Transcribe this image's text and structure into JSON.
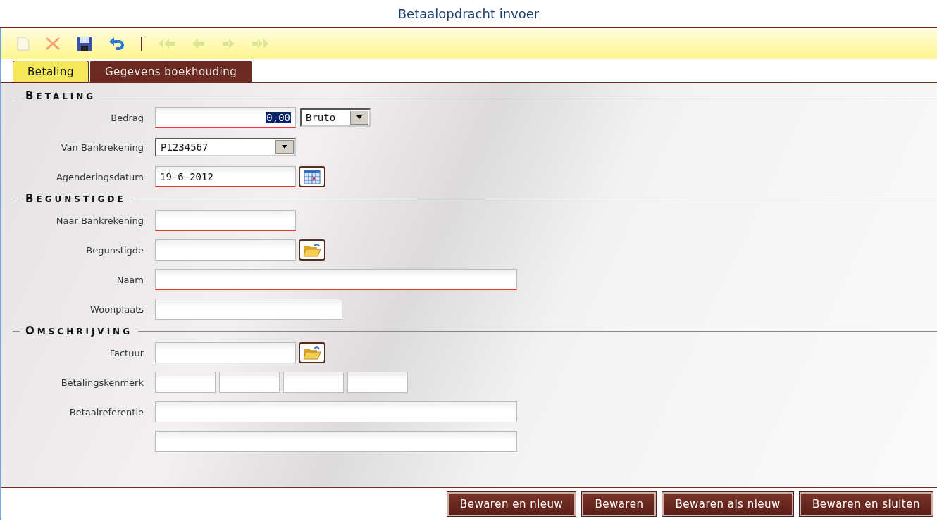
{
  "window": {
    "title": "Betaalopdracht invoer"
  },
  "toolbar": [
    {
      "kind": "new",
      "disabled": false
    },
    {
      "kind": "delete",
      "disabled": false
    },
    {
      "kind": "save",
      "disabled": false
    },
    {
      "kind": "undo",
      "disabled": false
    },
    {
      "kind": "separator"
    },
    {
      "kind": "first",
      "disabled": true
    },
    {
      "kind": "previous",
      "disabled": true
    },
    {
      "kind": "next",
      "disabled": true
    },
    {
      "kind": "last",
      "disabled": true
    }
  ],
  "tabs": [
    {
      "label": "Betaling",
      "selected": true
    },
    {
      "label": "Gegevens boekhouding",
      "selected": false
    }
  ],
  "sections": [
    {
      "title": "BETALING",
      "fields": [
        {
          "label": "Bedrag",
          "kind": "amount",
          "value": "0,00",
          "required": true,
          "unit": "Bruto"
        },
        {
          "label": "Van Bankrekening",
          "kind": "select",
          "value": "P1234567"
        },
        {
          "label": "Agenderingsdatum",
          "kind": "date",
          "value": "19-6-2012",
          "required": true
        }
      ]
    },
    {
      "title": "BEGUNSTIGDE",
      "fields": [
        {
          "label": "Naar Bankrekening",
          "kind": "text",
          "required": true
        },
        {
          "label": "Begunstigde",
          "kind": "lookup",
          "required": false
        },
        {
          "label": "Naam",
          "kind": "longtext",
          "required": true
        },
        {
          "label": "Woonplaats",
          "kind": "shorttext",
          "required": false
        }
      ]
    },
    {
      "title": "OMSCHRIJVING",
      "fields": [
        {
          "label": "Factuur",
          "kind": "lookup",
          "required": false
        },
        {
          "label": "Betalingskenmerk",
          "kind": "multi",
          "required": false
        },
        {
          "label": "Betaalreferentie",
          "kind": "longtext",
          "required": false
        },
        {
          "kind": "longtext",
          "required": false
        }
      ]
    }
  ],
  "buttons": [
    "Bewaren en nieuw",
    "Bewaren",
    "Bewaren als nieuw",
    "Bewaren en sluiten"
  ]
}
